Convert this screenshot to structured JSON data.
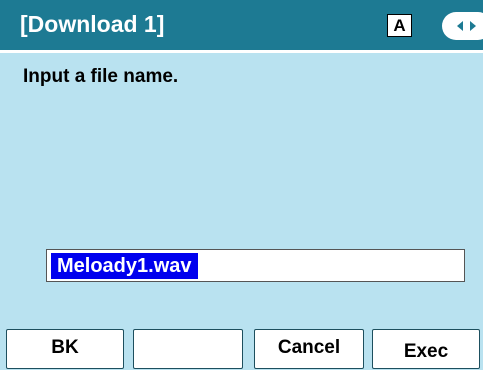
{
  "header": {
    "title": "[Download 1]",
    "input_mode": "A"
  },
  "main": {
    "prompt": "Input a file name.",
    "filename_value": "Meloady1.wav"
  },
  "softkeys": [
    "BK",
    "",
    "Cancel",
    "Exec"
  ],
  "colors": {
    "background": "#b9e2f0",
    "header": "#1d7a93",
    "selection": "#0000ee"
  },
  "icons": [
    "nav-left-icon",
    "nav-right-icon"
  ]
}
